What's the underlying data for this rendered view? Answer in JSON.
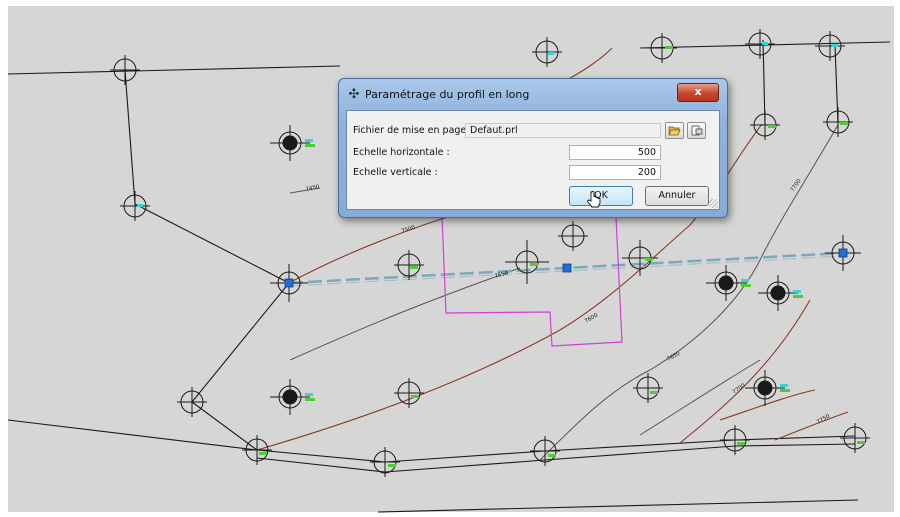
{
  "dialog": {
    "title": "Paramétrage du profil en long",
    "close_glyph": "x",
    "fields": {
      "layout_file_label": "Fichier de mise en page :",
      "layout_file_value": "Defaut.prl",
      "h_scale_label": "Echelle horizontale :",
      "h_scale_value": "500",
      "v_scale_label": "Echelle verticale :",
      "v_scale_value": "200"
    },
    "buttons": {
      "ok": "OK",
      "cancel": "Annuler"
    },
    "icons": {
      "title": "grid-cross-icon",
      "open": "folder-open-icon",
      "edit": "page-properties-icon"
    }
  },
  "drawing": {
    "contour_labels": [
      "7450",
      "7500",
      "7550",
      "7600",
      "7650",
      "7700",
      "7750",
      "7650",
      "7700"
    ],
    "colors": {
      "background": "#d6d6d6",
      "linework": "#1a1a1a",
      "contour": "#8a3a24",
      "contour_grey": "#555555",
      "profile_axis": "#7ea8b8",
      "selection": "#d43fd4",
      "grip": "#1f6fd6",
      "label_green": "#4dcc33",
      "label_cyan": "#33d6d6"
    }
  }
}
